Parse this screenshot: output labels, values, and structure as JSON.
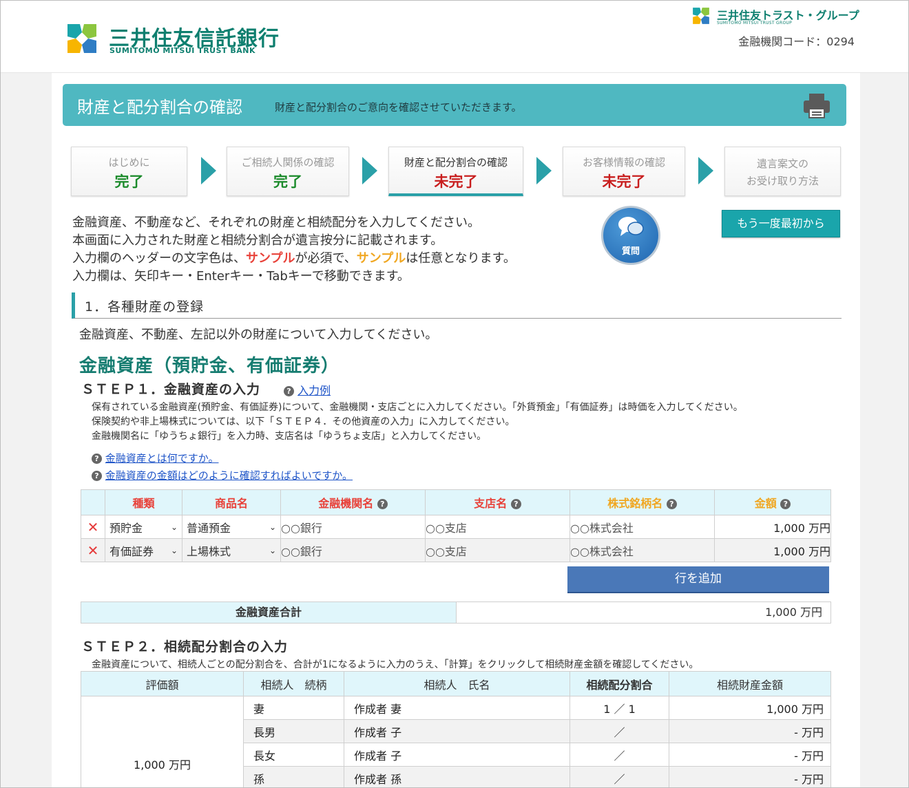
{
  "header": {
    "bank_name_jp": "三井住友信託銀行",
    "bank_name_en": "SUMITOMO MITSUI TRUST BANK",
    "group_name_jp": "三井住友トラスト・グループ",
    "group_name_en": "SUMITOMO MITSUI TRUST GROUP",
    "bank_code": "金融機関コード：0294"
  },
  "titlebar": {
    "title": "財産と配分割合の確認",
    "subtitle": "財産と配分割合のご意向を確認させていただきます。",
    "print_icon": "printer-icon"
  },
  "steps": [
    {
      "label": "はじめに",
      "status": "完了"
    },
    {
      "label": "ご相続人関係の確認",
      "status": "完了"
    },
    {
      "label": "財産と配分割合の確認",
      "status": "未完了"
    },
    {
      "label": "お客様情報の確認",
      "status": "未完了"
    },
    {
      "label_line1": "遺言案文の",
      "label_line2": "お受け取り方法"
    }
  ],
  "intro": {
    "line1": "金融資産、不動産など、それぞれの財産と相続配分を入力してください。",
    "line2": "本画面に入力された財産と相続分割合が遺言按分に記載されます。",
    "line3_a": "入力欄のヘッダーの文字色は、",
    "line3_red": "サンプル",
    "line3_b": "が必須で、",
    "line3_orange": "サンプル",
    "line3_c": "は任意となります。",
    "line4": "入力欄は、矢印キー・Enterキー・Tabキーで移動できます。"
  },
  "question_button": {
    "label": "質問"
  },
  "restart_button": {
    "label": "もう一度最初から"
  },
  "section1": {
    "heading": "1．各種財産の登録",
    "description": "金融資産、不動産、左記以外の財産について入力してください。"
  },
  "financial": {
    "title": "金融資産（預貯金、有価証券）",
    "step1_title": "ＳＴＥＰ１．金融資産の入力",
    "example_link": "入力例",
    "notes": [
      "保有されている金融資産(預貯金、有価証券)について、金融機関・支店ごとに入力してください。「外貨預金」「有価証券」は時価を入力してください。",
      "保険契約や非上場株式については、以下「ＳＴＥＰ４．その他資産の入力」に入力してください。",
      "金融機関名に「ゆうちょ銀行」を入力時、支店名は「ゆうちょ支店」と入力してください。"
    ],
    "faq": [
      "金融資産とは何ですか。",
      "金融資産の金額はどのように確認すればよいですか。"
    ],
    "table": {
      "headers": [
        "種類",
        "商品名",
        "金融機関名",
        "支店名",
        "株式銘柄名",
        "金額"
      ],
      "rows": [
        {
          "type": "預貯金",
          "product": "普通預金",
          "institution": "○○銀行",
          "branch": "○○支店",
          "stock": "○○株式会社",
          "amount": "1,000 万円"
        },
        {
          "type": "有価証券",
          "product": "上場株式",
          "institution": "○○銀行",
          "branch": "○○支店",
          "stock": "○○株式会社",
          "amount": "1,000 万円"
        }
      ]
    },
    "add_row_label": "行を追加",
    "total_label": "金融資産合計",
    "total_value": "1,000 万円"
  },
  "step2": {
    "title": "ＳＴＥＰ２．相続配分割合の入力",
    "note": "金融資産について、相続人ごとの配分割合を、合計が1になるように入力のうえ、「計算」をクリックして相続財産金額を確認してください。",
    "headers": [
      "評価額",
      "相続人　続柄",
      "相続人　氏名",
      "相続配分割合",
      "相続財産金額"
    ],
    "valuation": "1,000 万円",
    "rows": [
      {
        "relation": "妻",
        "name": "作成者 妻",
        "ratio": "1 ／ 1",
        "amount": "1,000 万円"
      },
      {
        "relation": "長男",
        "name": "作成者 子",
        "ratio": "／",
        "amount": "- 万円"
      },
      {
        "relation": "長女",
        "name": "作成者 子",
        "ratio": "／",
        "amount": "- 万円"
      },
      {
        "relation": "孫",
        "name": "作成者 孫",
        "ratio": "／",
        "amount": "- 万円"
      }
    ]
  },
  "colors": {
    "teal": "#4fb8c1",
    "brand_green": "#0d7f6f",
    "done": "#1a8a2a",
    "not_done": "#c81e1e",
    "required": "#e8423a",
    "optional": "#f0a722",
    "add_button": "#4a78b8"
  }
}
